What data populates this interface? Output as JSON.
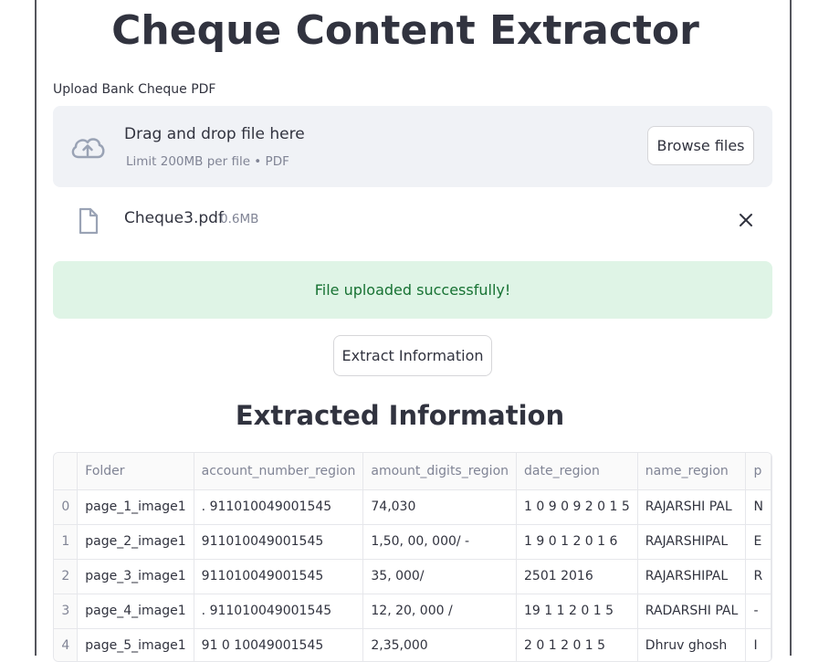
{
  "page": {
    "title": "Cheque Content Extractor",
    "section_title": "Extracted Information"
  },
  "uploader": {
    "label": "Upload Bank Cheque PDF",
    "drop_text": "Drag and drop file here",
    "limit_text": "Limit 200MB per file • PDF",
    "browse_label": "Browse files",
    "cloud_icon": "cloud-upload-icon"
  },
  "uploaded_file": {
    "name": "Cheque3.pdf",
    "size": "0.6MB",
    "file_icon": "document-icon",
    "close_icon": "close-icon"
  },
  "status": {
    "message": "File uploaded successfully!"
  },
  "actions": {
    "extract_label": "Extract Information"
  },
  "table": {
    "columns": [
      "",
      "Folder",
      "account_number_region",
      "amount_digits_region",
      "date_region",
      "name_region",
      "p"
    ],
    "rows": [
      [
        "0",
        "page_1_image1",
        ". 911010049001545",
        "74,030",
        "1 0 9 0 9 2 0 1 5",
        "RAJARSHI PAL",
        "N"
      ],
      [
        "1",
        "page_2_image1",
        "911010049001545",
        "1,50, 00, 000/ -",
        "1 9 0 1 2 0 1 6",
        "RAJARSHIPAL",
        "E"
      ],
      [
        "2",
        "page_3_image1",
        "911010049001545",
        "35, 000/",
        "2501 2016",
        "RAJARSHIPAL",
        "R"
      ],
      [
        "3",
        "page_4_image1",
        ". 911010049001545",
        "12, 20, 000 /",
        "19 1 1 2 0 1 5",
        "RADARSHI PAL",
        "-"
      ],
      [
        "4",
        "page_5_image1",
        "91 0 10049001545",
        "2,35,000",
        "2 0 1 2 0 1 5",
        "Dhruv ghosh",
        "I"
      ]
    ]
  },
  "colors": {
    "text": "#31333f",
    "muted": "#808495",
    "dropzone_bg": "#f0f2f6",
    "success_bg": "#dff4e6",
    "success_text": "#177233"
  }
}
